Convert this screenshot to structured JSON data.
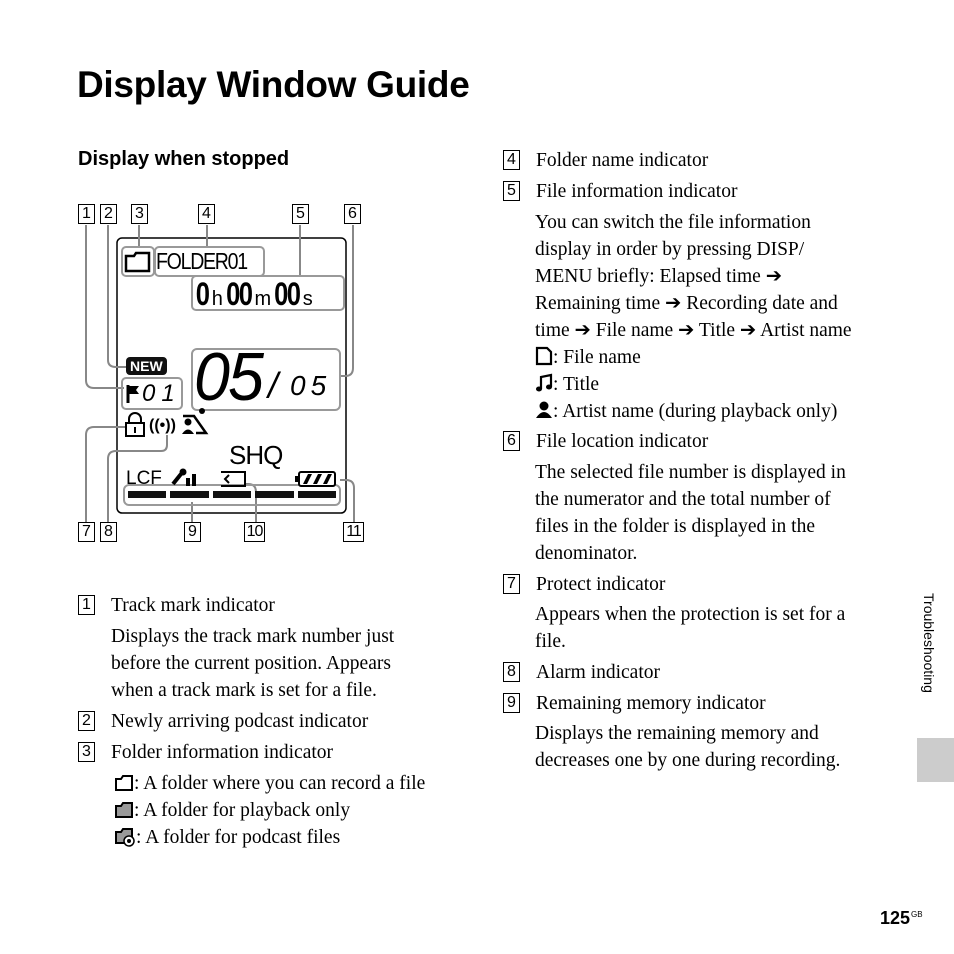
{
  "page": {
    "title": "Display Window Guide",
    "subtitle": "Display when stopped",
    "side_tab": "Troubleshooting",
    "page_number": "125",
    "page_suffix": "GB"
  },
  "diagram": {
    "callouts": [
      "1",
      "2",
      "3",
      "4",
      "5",
      "6",
      "7",
      "8",
      "9",
      "10",
      "11"
    ],
    "lcd": {
      "folder_name": "FOLDER01",
      "time": {
        "h": "0",
        "h_unit": "h",
        "m": "00",
        "m_unit": "m",
        "s": "00",
        "s_unit": "s"
      },
      "new_badge": "NEW",
      "track_mark": "01",
      "file_current": "05",
      "file_separator": "/",
      "file_total": "05",
      "rec_mode": "SHQ",
      "lcf": "LCF",
      "battery_level": 1.0,
      "memory_segments": 5
    }
  },
  "left_items": [
    {
      "num": "1",
      "label": "Track mark indicator",
      "desc": [
        "Displays the track mark number just",
        "before the current position. Appears",
        "when a track mark is set for a file."
      ]
    },
    {
      "num": "2",
      "label": "Newly arriving podcast indicator",
      "desc": []
    },
    {
      "num": "3",
      "label": "Folder information indicator",
      "desc": []
    }
  ],
  "folder_legend": [
    {
      "icon": "folder-outline-icon",
      "text": ": A folder where you can record a file"
    },
    {
      "icon": "folder-filled-icon",
      "text": ": A folder for playback only"
    },
    {
      "icon": "folder-podcast-icon",
      "text": ": A folder for podcast files"
    }
  ],
  "right_items": [
    {
      "num": "4",
      "label": "Folder name indicator",
      "desc": []
    },
    {
      "num": "5",
      "label": "File information indicator",
      "desc": [
        "You can switch the file information",
        "display in order by pressing DISP/",
        "MENU briefly: Elapsed time ➔",
        "Remaining time ➔ Recording date and",
        "time ➔ File name ➔ Title ➔ Artist name"
      ]
    },
    {
      "num": "6",
      "label": "File location indicator",
      "desc": [
        "The selected file number is displayed in",
        "the numerator and the total number of",
        "files in the folder is displayed in the",
        "denominator."
      ]
    },
    {
      "num": "7",
      "label": "Protect indicator",
      "desc": [
        "Appears when the protection is set for a",
        "file."
      ]
    },
    {
      "num": "8",
      "label": "Alarm indicator",
      "desc": []
    },
    {
      "num": "9",
      "label": "Remaining memory indicator",
      "desc": [
        "Displays the remaining memory and",
        "decreases one by one during recording."
      ]
    }
  ],
  "file_info_legend": [
    {
      "icon": "file-icon",
      "text": ": File name"
    },
    {
      "icon": "music-note-icon",
      "text": ": Title"
    },
    {
      "icon": "person-icon",
      "text": ": Artist name (during playback only)"
    }
  ]
}
